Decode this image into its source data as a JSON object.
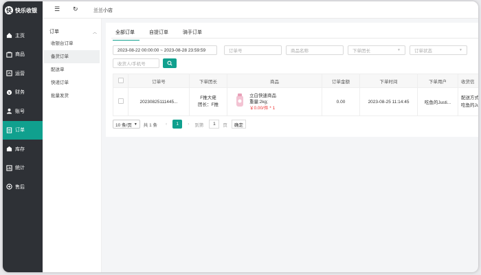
{
  "app": {
    "name": "快乐收银",
    "logo_letter": "快"
  },
  "topbar": {
    "shop_name": "兰兰小店",
    "menu_icon": "☰",
    "refresh_icon": "↻"
  },
  "sidebar": {
    "items": [
      {
        "label": "主页",
        "icon": "home-icon"
      },
      {
        "label": "商品",
        "icon": "goods-icon"
      },
      {
        "label": "运营",
        "icon": "operation-icon"
      },
      {
        "label": "财务",
        "icon": "finance-icon"
      },
      {
        "label": "账号",
        "icon": "account-icon"
      },
      {
        "label": "订单",
        "icon": "order-icon"
      },
      {
        "label": "库存",
        "icon": "stock-icon"
      },
      {
        "label": "统计",
        "icon": "stats-icon"
      },
      {
        "label": "售后",
        "icon": "aftersale-icon"
      }
    ],
    "active": "订单"
  },
  "subnav": {
    "title": "订单",
    "items": [
      "收银台订单",
      "备货订单",
      "配送单",
      "快递订单",
      "批量发货"
    ],
    "active": "备货订单"
  },
  "tabs": [
    "全部订单",
    "自提订单",
    "骑手订单"
  ],
  "filters": {
    "date_range": "2023-08-22 00:00:00 ~ 2023-08-28 23:59:59",
    "order_no_placeholder": "订单号",
    "product_placeholder": "商品名称",
    "leader_placeholder": "下单团长",
    "status_placeholder": "订单状态",
    "buyer_placeholder": "收货人/手机号"
  },
  "table": {
    "headers": [
      "订单号",
      "下单团长",
      "商品",
      "订单金额",
      "下单时间",
      "下单用户",
      "收货信"
    ],
    "rows": [
      {
        "order_no": "20230825111445...",
        "leader_line1": "F推大佬",
        "leader_line2": "团长：F推",
        "product_name": "立白快速商品",
        "product_weight": "重量:2kg;",
        "product_price": "￥0.00/件 * 1",
        "amount": "0.00",
        "time": "2023-08-25 11:14:45",
        "user": "吃鱼的Justi...",
        "delivery_line1": "配送方式：",
        "delivery_line2": "吃鱼的Justi"
      }
    ]
  },
  "pager": {
    "page_size": "10 条/页",
    "total": "共 1 条",
    "current": "1",
    "goto_label": "到第",
    "goto_value": "1",
    "page_unit": "页",
    "confirm": "确定"
  },
  "colors": {
    "accent": "#10a08e",
    "sidebar": "#2e3136",
    "price": "#e33"
  }
}
